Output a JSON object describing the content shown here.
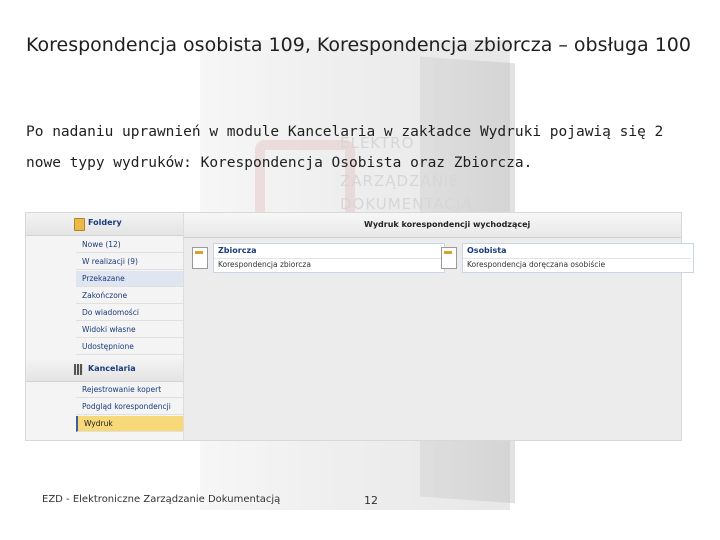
{
  "slide": {
    "title": "Korespondencja osobista 109, Korespondencja zbiorcza – obsługa 100",
    "body": "Po nadaniu uprawnień w module Kancelaria w zakładce Wydruki pojawią się 2 nowe typy wydruków: Korespondencja Osobista oraz Zbiorcza.",
    "background_words": [
      "ELEKTRO",
      "ZARZĄDZANIE",
      "DOKUMENTACJĄ"
    ]
  },
  "screenshot": {
    "sidebar": {
      "folders_header": "Foldery",
      "folders": [
        "Nowe (12)",
        "W realizacji (9)",
        "Przekazane",
        "Zakończone",
        "Do wiadomości",
        "Widoki własne",
        "Udostępnione"
      ],
      "kancelaria_header": "Kancelaria",
      "kancelaria_items": [
        "Rejestrowanie kopert",
        "Podgląd korespondencji",
        "Wydruk"
      ]
    },
    "main_title": "Wydruk korespondencji wychodzącej",
    "cards": [
      {
        "title": "Zbiorcza",
        "subtitle": "Korespondencja zbiorcza"
      },
      {
        "title": "Osobista",
        "subtitle": "Korespondencja doręczana osobiście"
      }
    ]
  },
  "footer": {
    "left_text": "EZD - Elektroniczne Zarządzanie Dokumentacją",
    "page_number": "12"
  }
}
